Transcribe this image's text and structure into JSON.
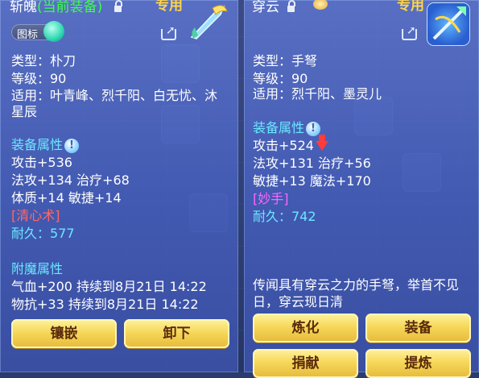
{
  "left": {
    "name": "斩魄",
    "equipped_tag": "(当前装备)",
    "exclusive": "专用",
    "badge_label": "图标",
    "type_line": "类型：朴刀",
    "level_line": "等级：90",
    "fit_line1": "适用：叶青峰、烈千阳、白无忧、沐",
    "fit_line2": "星辰",
    "attr_title": "装备属性",
    "attack": "攻击+536",
    "mag_heal": "法攻+134 治疗+68",
    "con_agi": "体质+14 敏捷+14",
    "skill": "[清心术]",
    "durability": "耐久：577",
    "enchant_title": "附魔属性",
    "enchant1": "气血+200 持续到8月21日 14:22",
    "enchant2": "物抗+33 持续到8月21日 14:22",
    "buttons": [
      "镶嵌",
      "卸下"
    ]
  },
  "right": {
    "name": "穿云",
    "exclusive": "专用",
    "type_line": "类型：手弩",
    "level_line": "等级：90",
    "fit_line": "适用：烈千阳、墨灵儿",
    "attr_title": "装备属性",
    "attack": "攻击+524",
    "mag_heal": "法攻+131 治疗+56",
    "agi_magic": "敏捷+13 魔法+170",
    "skill": "[妙手]",
    "durability": "耐久：742",
    "desc1": "传闻具有穿云之力的手弩，举首不见",
    "desc2": "日，穿云现日清",
    "buttons": [
      "炼化",
      "装备",
      "捐献",
      "提炼"
    ]
  },
  "colors": {
    "equipped": "#3cff4a",
    "section": "#6be7ff",
    "skill_left": "#ff6868",
    "skill_right": "#ff66ff",
    "button_text": "#5a2a0c"
  }
}
